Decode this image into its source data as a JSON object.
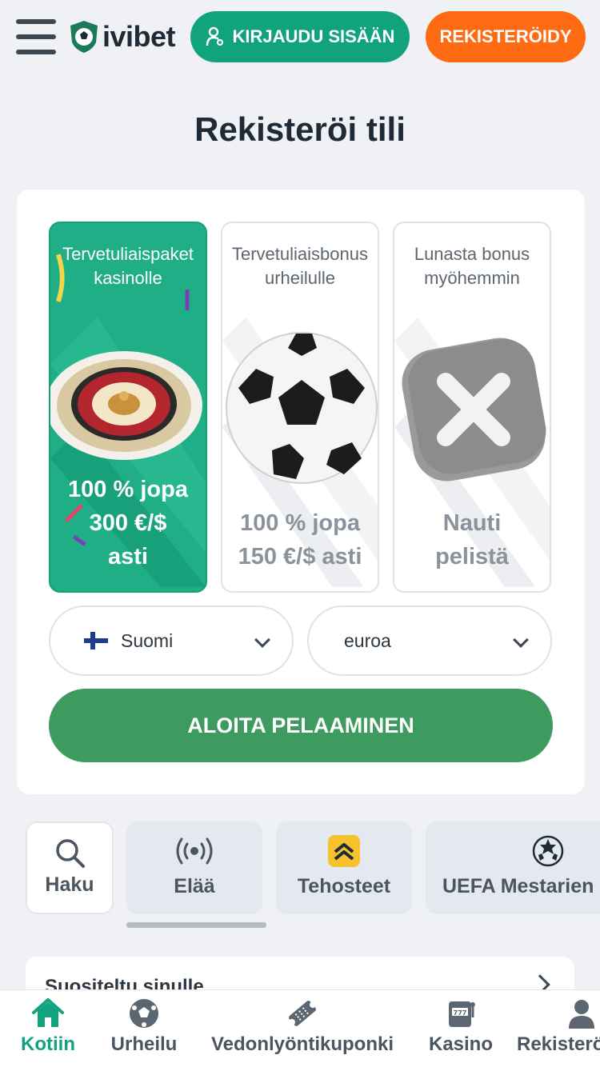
{
  "header": {
    "logo_text": "ivibet",
    "login_label": "KIRJAUDU SISÄÄN",
    "register_label": "REKISTERÖIDY",
    "colors": {
      "login": "#10a37d",
      "register": "#ff6b12"
    }
  },
  "page_title": "Rekisteröi tili",
  "bonuses": [
    {
      "title_line1": "Tervetuliaispaket",
      "title_line2": "kasinolle",
      "amount_line1": "100 % jopa",
      "amount_line2": "300 €/$",
      "amount_line3": "asti",
      "icon": "roulette-icon",
      "selected": true
    },
    {
      "title_line1": "Tervetuliaisbonus",
      "title_line2": "urheilulle",
      "amount_line1": "100 % jopa",
      "amount_line2": "150 €/$ asti",
      "icon": "soccer-ball-icon",
      "selected": false
    },
    {
      "title_line1": "Lunasta bonus",
      "title_line2": "myöhemmin",
      "amount_line1": "Nauti",
      "amount_line2": "pelistä",
      "icon": "close-icon",
      "selected": false
    }
  ],
  "country_select": {
    "value": "Suomi",
    "flag": "finland-flag-icon"
  },
  "currency_select": {
    "value": "euroa"
  },
  "start_button": "ALOITA PELAAMINEN",
  "categories": [
    {
      "label": "Haku",
      "icon": "search-icon"
    },
    {
      "label": "Elää",
      "icon": "live-broadcast-icon"
    },
    {
      "label": "Tehosteet",
      "icon": "boost-icon"
    },
    {
      "label": "UEFA Mestarien",
      "icon": "champions-league-icon"
    }
  ],
  "recommended": {
    "title": "Suositeltu sinulle"
  },
  "bottom_nav": [
    {
      "label": "Kotiin",
      "icon": "home-icon",
      "active": true
    },
    {
      "label": "Urheilu",
      "icon": "soccer-ball-icon",
      "active": false
    },
    {
      "label": "Vedonlyöntikuponki",
      "icon": "ticket-icon",
      "active": false
    },
    {
      "label": "Kasino",
      "icon": "slot-machine-icon",
      "active": false
    },
    {
      "label": "Rekisteröidy",
      "icon": "user-icon",
      "active": false
    }
  ]
}
